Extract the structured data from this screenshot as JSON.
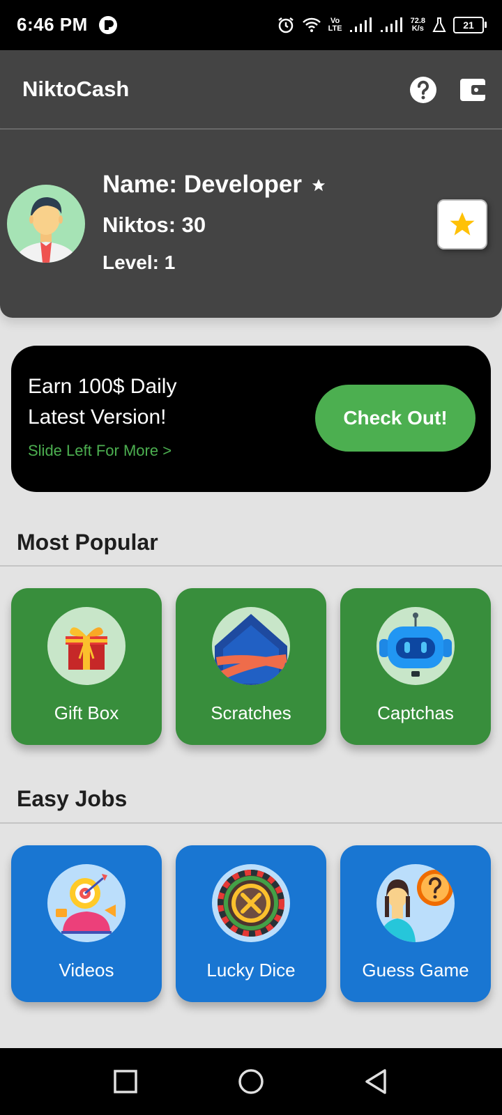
{
  "status_bar": {
    "time": "6:46 PM",
    "network_top": "Vo",
    "network_bottom": "LTE",
    "speed_value": "72.8",
    "speed_unit": "K/s",
    "battery": "21"
  },
  "app_bar": {
    "title": "NiktoCash",
    "help_icon": "help-circle-icon",
    "wallet_icon": "wallet-icon"
  },
  "profile": {
    "name": "Name: Developer",
    "niktos": "Niktos: 30",
    "level": "Level: 1",
    "avatar_icon": "businessman-avatar-icon",
    "rate_icon": "star-icon"
  },
  "promo": {
    "line1": "Earn 100$ Daily",
    "line2": "Latest Version!",
    "hint": "Slide Left For More >",
    "cta": "Check Out!"
  },
  "sections": {
    "popular": {
      "title": "Most Popular",
      "items": [
        {
          "label": "Gift Box",
          "icon": "gift-box-icon"
        },
        {
          "label": "Scratches",
          "icon": "scratch-card-icon"
        },
        {
          "label": "Captchas",
          "icon": "robot-icon"
        }
      ]
    },
    "easy": {
      "title": "Easy Jobs",
      "items": [
        {
          "label": "Videos",
          "icon": "target-idea-icon"
        },
        {
          "label": "Lucky Dice",
          "icon": "roulette-wheel-icon"
        },
        {
          "label": "Guess Game",
          "icon": "question-person-icon"
        }
      ]
    }
  },
  "colors": {
    "popular_card": "#388e3c",
    "easy_card": "#1976d2",
    "accent_green": "#4caf50",
    "header_bg": "#444444"
  },
  "nav_bar": {
    "items": [
      "recent-apps-icon",
      "home-icon",
      "back-icon"
    ]
  }
}
